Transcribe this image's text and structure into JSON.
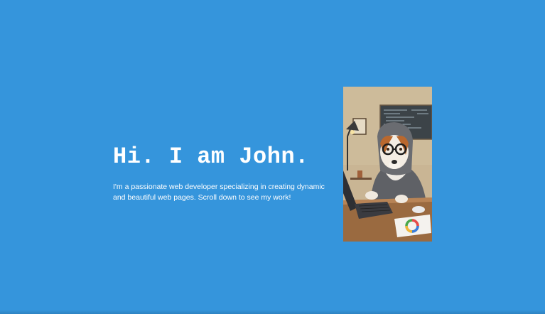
{
  "hero": {
    "headline": "Hi. I am John.",
    "intro": "I'm a passionate web developer specializing in creating dynamic and beautiful web pages. Scroll down to see my work!"
  },
  "colors": {
    "background": "#3595dc",
    "text": "#ffffff"
  },
  "portrait": {
    "icon": "dog-developer-illustration"
  }
}
